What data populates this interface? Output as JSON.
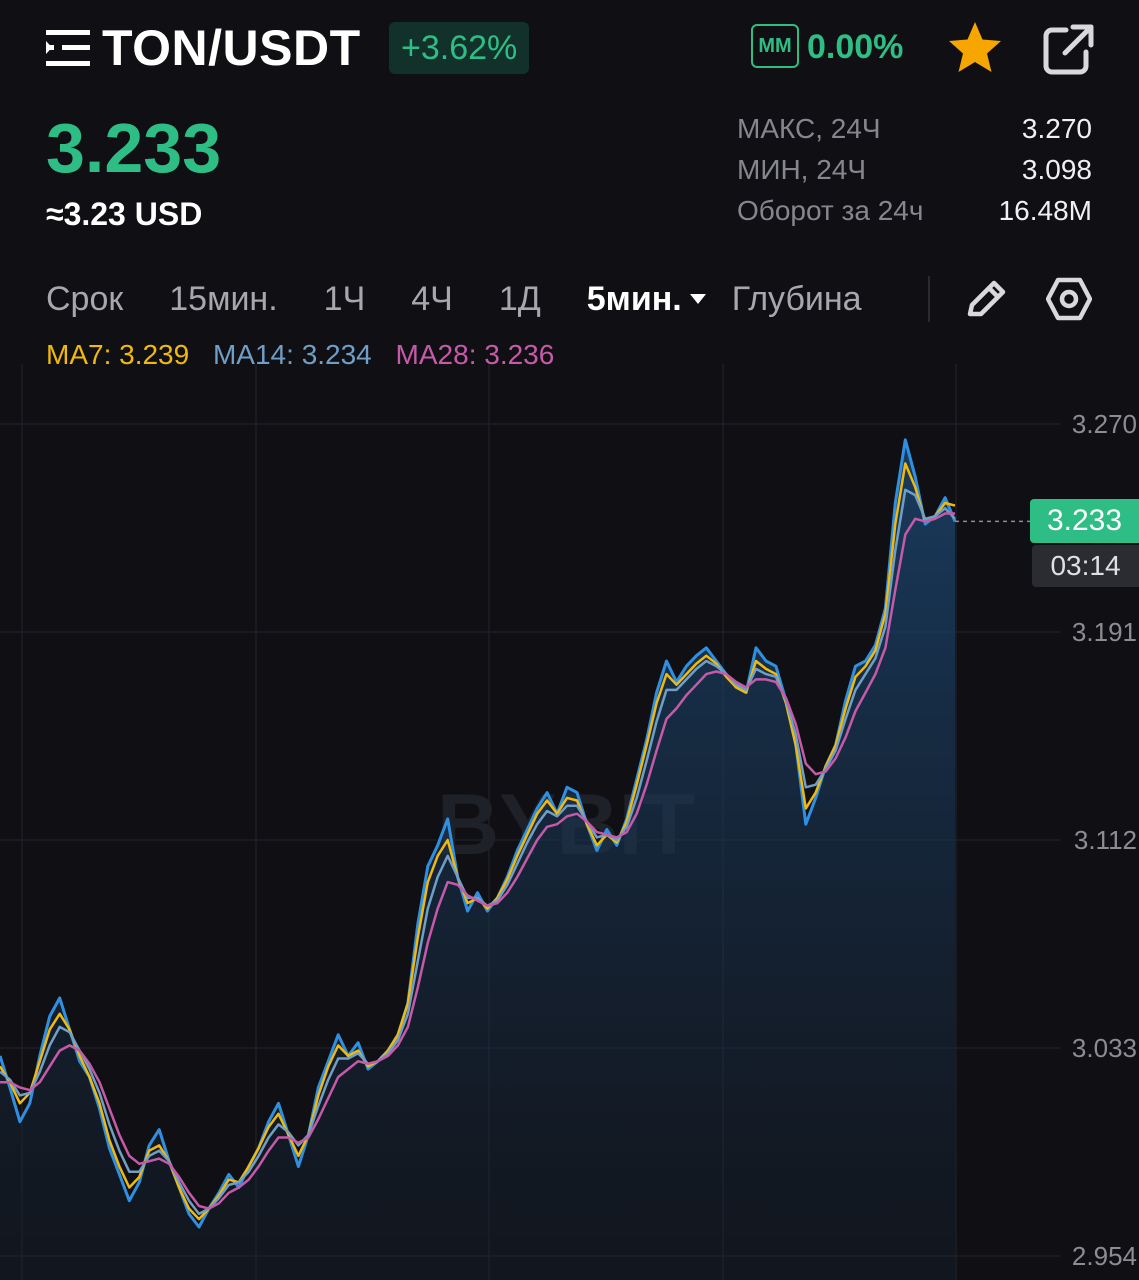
{
  "header": {
    "pair": "TON/USDT",
    "change": "+3.62%",
    "mm_label": "MM",
    "mm_value": "0.00%",
    "icons": [
      "menu-icon",
      "star-icon",
      "external-link-icon"
    ],
    "colors": {
      "up": "#2ebd85",
      "star": "#f7a600",
      "background": "#101014"
    }
  },
  "price": {
    "last": "3.233",
    "usd": "≈3.23 USD"
  },
  "stats": [
    {
      "label": "МАКС, 24Ч",
      "value": "3.270"
    },
    {
      "label": "МИН, 24Ч",
      "value": "3.098"
    },
    {
      "label": "Оборот за 24ч",
      "value": "16.48M"
    }
  ],
  "tabs": {
    "items": [
      "Срок",
      "15мин.",
      "1Ч",
      "4Ч",
      "1Д"
    ],
    "active": "5мин.",
    "depth": "Глубина",
    "icons": [
      "pencil-icon",
      "settings-icon"
    ]
  },
  "ma_legend": [
    {
      "text": "MA7: 3.239",
      "color": "#f0b90b"
    },
    {
      "text": "MA14: 3.234",
      "color": "#6f9ec6"
    },
    {
      "text": "MA28: 3.236",
      "color": "#c55aa8"
    }
  ],
  "chart_data": {
    "type": "line",
    "title": "",
    "xlabel": "",
    "ylabel": "",
    "y_ticks": [
      "3.270",
      "3.191",
      "3.112",
      "3.033",
      "2.954"
    ],
    "ylim": [
      2.954,
      3.27
    ],
    "grid": true,
    "current_price_label": "3.233",
    "countdown": "03:14",
    "watermark": "BYBIT",
    "series": [
      {
        "name": "",
        "color": "#2f8fe0",
        "values": [
          3.03,
          3.018,
          3.005,
          3.012,
          3.03,
          3.045,
          3.052,
          3.04,
          3.028,
          3.022,
          3.01,
          2.995,
          2.985,
          2.975,
          2.982,
          2.996,
          3.002,
          2.99,
          2.98,
          2.97,
          2.965,
          2.972,
          2.978,
          2.985,
          2.98,
          2.988,
          2.995,
          3.005,
          3.012,
          3.0,
          2.988,
          3.0,
          3.018,
          3.028,
          3.038,
          3.03,
          3.035,
          3.025,
          3.028,
          3.032,
          3.038,
          3.05,
          3.08,
          3.102,
          3.11,
          3.12,
          3.098,
          3.085,
          3.092,
          3.085,
          3.09,
          3.098,
          3.108,
          3.116,
          3.124,
          3.13,
          3.122,
          3.132,
          3.13,
          3.118,
          3.108,
          3.116,
          3.11,
          3.12,
          3.135,
          3.15,
          3.168,
          3.18,
          3.172,
          3.178,
          3.182,
          3.185,
          3.18,
          3.175,
          3.17,
          3.168,
          3.185,
          3.18,
          3.178,
          3.165,
          3.148,
          3.118,
          3.128,
          3.14,
          3.148,
          3.165,
          3.178,
          3.18,
          3.186,
          3.2,
          3.24,
          3.264,
          3.25,
          3.232,
          3.235,
          3.242,
          3.233
        ]
      },
      {
        "name": "MA7",
        "color": "#f0b90b",
        "values": [
          3.026,
          3.02,
          3.012,
          3.016,
          3.028,
          3.04,
          3.046,
          3.04,
          3.03,
          3.022,
          3.012,
          2.998,
          2.988,
          2.98,
          2.984,
          2.994,
          2.996,
          2.99,
          2.98,
          2.972,
          2.968,
          2.972,
          2.977,
          2.983,
          2.982,
          2.988,
          2.995,
          3.003,
          3.008,
          3.0,
          2.992,
          3.0,
          3.015,
          3.026,
          3.034,
          3.03,
          3.032,
          3.026,
          3.028,
          3.032,
          3.038,
          3.05,
          3.075,
          3.096,
          3.106,
          3.112,
          3.098,
          3.088,
          3.09,
          3.086,
          3.09,
          3.097,
          3.106,
          3.114,
          3.122,
          3.127,
          3.122,
          3.128,
          3.127,
          3.118,
          3.11,
          3.114,
          3.111,
          3.119,
          3.133,
          3.148,
          3.164,
          3.175,
          3.171,
          3.175,
          3.179,
          3.182,
          3.179,
          3.174,
          3.17,
          3.168,
          3.18,
          3.177,
          3.175,
          3.164,
          3.148,
          3.124,
          3.13,
          3.14,
          3.148,
          3.162,
          3.174,
          3.178,
          3.184,
          3.198,
          3.232,
          3.255,
          3.246,
          3.233,
          3.235,
          3.24,
          3.239
        ]
      },
      {
        "name": "MA14",
        "color": "#6f9ec6",
        "values": [
          3.024,
          3.021,
          3.015,
          3.016,
          3.024,
          3.034,
          3.041,
          3.039,
          3.032,
          3.025,
          3.016,
          3.004,
          2.994,
          2.986,
          2.986,
          2.992,
          2.994,
          2.99,
          2.982,
          2.975,
          2.97,
          2.972,
          2.976,
          2.981,
          2.982,
          2.986,
          2.992,
          2.999,
          3.004,
          3.001,
          2.996,
          3.0,
          3.011,
          3.021,
          3.029,
          3.029,
          3.031,
          3.027,
          3.028,
          3.031,
          3.036,
          3.046,
          3.066,
          3.086,
          3.098,
          3.106,
          3.098,
          3.09,
          3.09,
          3.087,
          3.089,
          3.095,
          3.103,
          3.111,
          3.118,
          3.123,
          3.121,
          3.125,
          3.125,
          3.119,
          3.113,
          3.114,
          3.112,
          3.117,
          3.128,
          3.142,
          3.157,
          3.169,
          3.169,
          3.173,
          3.177,
          3.18,
          3.178,
          3.175,
          3.171,
          3.169,
          3.177,
          3.175,
          3.174,
          3.165,
          3.152,
          3.132,
          3.133,
          3.139,
          3.146,
          3.158,
          3.169,
          3.175,
          3.181,
          3.193,
          3.222,
          3.245,
          3.243,
          3.234,
          3.235,
          3.238,
          3.234
        ]
      },
      {
        "name": "MA28",
        "color": "#c55aa8",
        "values": [
          3.02,
          3.02,
          3.018,
          3.017,
          3.02,
          3.026,
          3.032,
          3.034,
          3.032,
          3.027,
          3.02,
          3.01,
          3.0,
          2.992,
          2.989,
          2.99,
          2.991,
          2.989,
          2.984,
          2.978,
          2.973,
          2.972,
          2.974,
          2.978,
          2.98,
          2.983,
          2.988,
          2.994,
          2.999,
          2.999,
          2.997,
          2.999,
          3.006,
          3.014,
          3.022,
          3.025,
          3.028,
          3.027,
          3.028,
          3.03,
          3.034,
          3.041,
          3.056,
          3.073,
          3.086,
          3.096,
          3.095,
          3.091,
          3.089,
          3.087,
          3.088,
          3.092,
          3.098,
          3.105,
          3.112,
          3.117,
          3.118,
          3.121,
          3.122,
          3.119,
          3.115,
          3.114,
          3.113,
          3.115,
          3.122,
          3.133,
          3.146,
          3.158,
          3.162,
          3.167,
          3.171,
          3.175,
          3.176,
          3.175,
          3.172,
          3.17,
          3.173,
          3.173,
          3.172,
          3.166,
          3.156,
          3.141,
          3.137,
          3.138,
          3.143,
          3.151,
          3.161,
          3.168,
          3.175,
          3.185,
          3.207,
          3.228,
          3.234,
          3.233,
          3.234,
          3.236,
          3.236
        ]
      }
    ]
  }
}
